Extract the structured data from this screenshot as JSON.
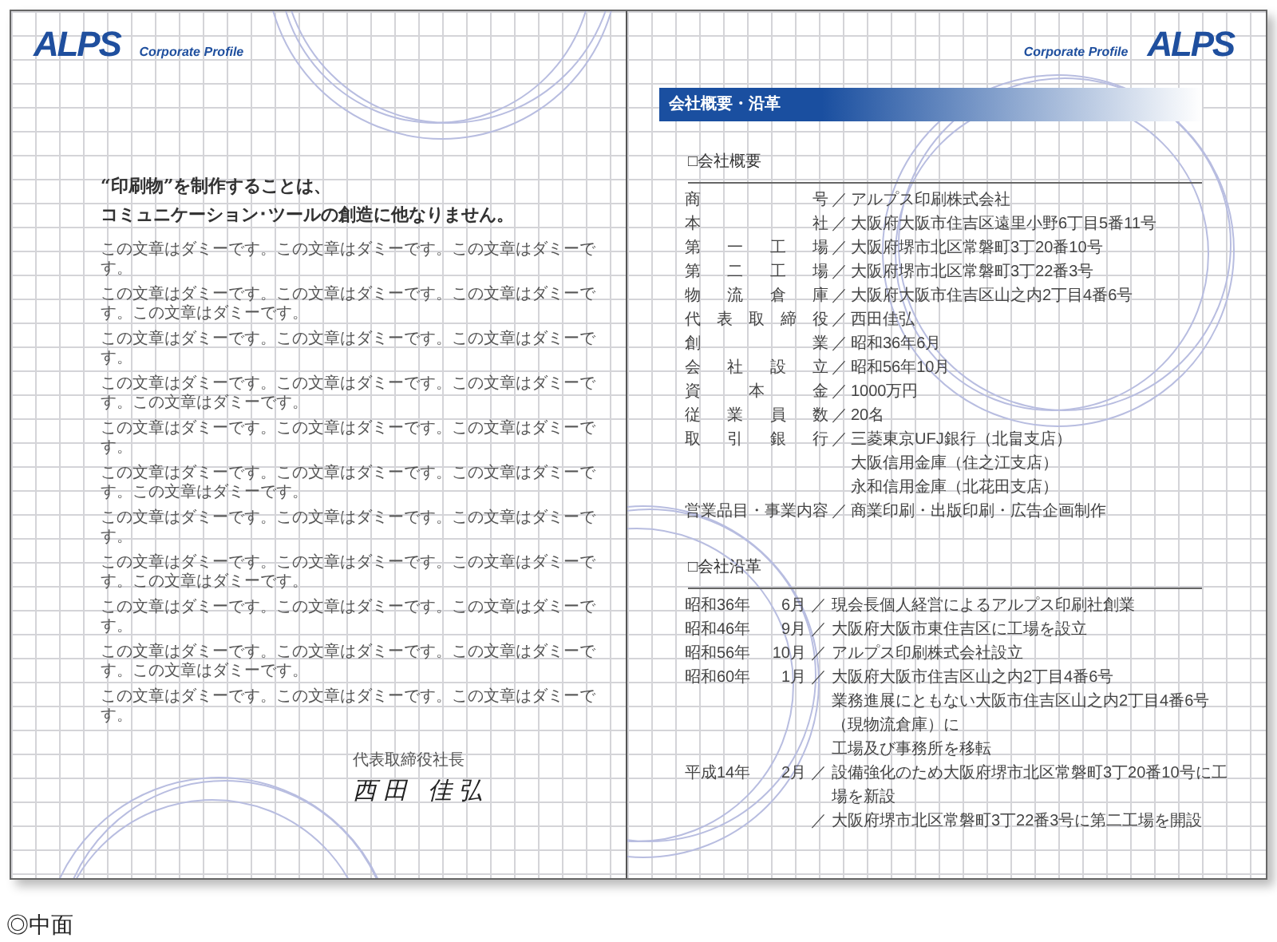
{
  "left_page": {
    "logo": "ALPS",
    "tagline": "Corporate Profile",
    "headline": [
      "“印刷物”を制作することは、",
      "コミュニケーション･ツールの創造に他なりません。"
    ],
    "body": [
      "この文章はダミーです。この文章はダミーです。この文章はダミーです。",
      "この文章はダミーです。この文章はダミーです。この文章はダミーです。この文章はダミーです。",
      "この文章はダミーです。この文章はダミーです。この文章はダミーです。",
      "この文章はダミーです。この文章はダミーです。この文章はダミーです。この文章はダミーです。",
      "この文章はダミーです。この文章はダミーです。この文章はダミーです。",
      "この文章はダミーです。この文章はダミーです。この文章はダミーです。この文章はダミーです。",
      "この文章はダミーです。この文章はダミーです。この文章はダミーです。",
      "この文章はダミーです。この文章はダミーです。この文章はダミーです。この文章はダミーです。",
      "この文章はダミーです。この文章はダミーです。この文章はダミーです。",
      "この文章はダミーです。この文章はダミーです。この文章はダミーです。この文章はダミーです。",
      "この文章はダミーです。この文章はダミーです。この文章はダミーです。"
    ],
    "signature_title": "代表取締役社長",
    "signature_name": "西田 佳弘"
  },
  "right_page": {
    "tagline": "Corporate Profile",
    "logo": "ALPS",
    "banner": "会社概要・沿革",
    "overview": {
      "heading": "□会社概要",
      "rows": [
        {
          "label": "商号",
          "sep": "／",
          "value": "アルプス印刷株式会社"
        },
        {
          "label": "本社",
          "sep": "／",
          "value": "大阪府大阪市住吉区遠里小野6丁目5番11号"
        },
        {
          "label": "第一工場",
          "sep": "／",
          "value": "大阪府堺市北区常磐町3丁20番10号"
        },
        {
          "label": "第二工場",
          "sep": "／",
          "value": "大阪府堺市北区常磐町3丁22番3号"
        },
        {
          "label": "物流倉庫",
          "sep": "／",
          "value": "大阪府大阪市住吉区山之内2丁目4番6号"
        },
        {
          "label": "代表取締役",
          "sep": "／",
          "value": "西田佳弘"
        },
        {
          "label": "創業",
          "sep": "／",
          "value": "昭和36年6月"
        },
        {
          "label": "会社設立",
          "sep": "／",
          "value": "昭和56年10月"
        },
        {
          "label": "資本金",
          "sep": "／",
          "value": "1000万円"
        },
        {
          "label": "従業員数",
          "sep": "／",
          "value": "20名"
        },
        {
          "label": "取引銀行",
          "sep": "／",
          "value": "三菱東京UFJ銀行（北畠支店）"
        },
        {
          "value": "大阪信用金庫（住之江支店）"
        },
        {
          "value": "永和信用金庫（北花田支店）"
        },
        {
          "label": "営業品目・事業内容",
          "sep": "／",
          "value": "商業印刷・出版印刷・広告企画制作"
        }
      ]
    },
    "history": {
      "heading": "□会社沿革",
      "rows": [
        {
          "year": "昭和36年",
          "month": "6月",
          "sep": "／",
          "text": "現会長個人経営によるアルプス印刷社創業"
        },
        {
          "year": "昭和46年",
          "month": "9月",
          "sep": "／",
          "text": "大阪府大阪市東住吉区に工場を設立"
        },
        {
          "year": "昭和56年",
          "month": "10月",
          "sep": "／",
          "text": "アルプス印刷株式会社設立"
        },
        {
          "year": "昭和60年",
          "month": "1月",
          "sep": "／",
          "text": "大阪府大阪市住吉区山之内2丁目4番6号"
        },
        {
          "text": "業務進展にともない大阪市住吉区山之内2丁目4番6号（現物流倉庫）に"
        },
        {
          "text": "工場及び事務所を移転"
        },
        {
          "year": "平成14年",
          "month": "2月",
          "sep": "／",
          "text": "設備強化のため大阪府堺市北区常磐町3丁20番10号に工場を新設"
        },
        {
          "sep": "／",
          "text": "大阪府堺市北区常磐町3丁22番3号に第二工場を開設"
        }
      ]
    }
  },
  "caption": "◎中面"
}
